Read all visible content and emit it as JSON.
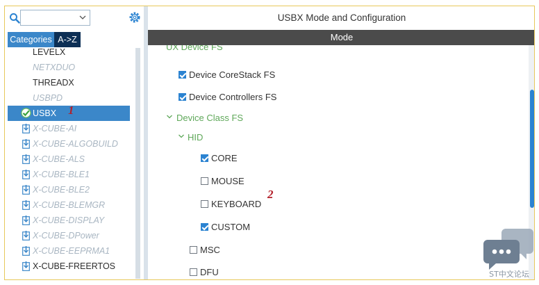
{
  "left_panel": {
    "search": {
      "value": "",
      "placeholder": ""
    },
    "tabs": [
      {
        "label": "Categories",
        "active": false
      },
      {
        "label": "A->Z",
        "active": true
      }
    ],
    "tree_items": [
      {
        "label": "LEVELX",
        "style": "plain"
      },
      {
        "label": "NETXDUO",
        "style": "muted"
      },
      {
        "label": "THREADX",
        "style": "plain"
      },
      {
        "label": "USBPD",
        "style": "muted"
      },
      {
        "label": "USBX",
        "style": "selected",
        "icon": "green-check-icon"
      },
      {
        "label": "X-CUBE-AI",
        "style": "muted",
        "icon": "download-icon"
      },
      {
        "label": "X-CUBE-ALGOBUILD",
        "style": "muted",
        "icon": "download-icon"
      },
      {
        "label": "X-CUBE-ALS",
        "style": "muted",
        "icon": "download-icon"
      },
      {
        "label": "X-CUBE-BLE1",
        "style": "muted",
        "icon": "download-icon"
      },
      {
        "label": "X-CUBE-BLE2",
        "style": "muted",
        "icon": "download-icon"
      },
      {
        "label": "X-CUBE-BLEMGR",
        "style": "muted",
        "icon": "download-icon"
      },
      {
        "label": "X-CUBE-DISPLAY",
        "style": "muted",
        "icon": "download-icon"
      },
      {
        "label": "X-CUBE-DPower",
        "style": "muted",
        "icon": "download-icon"
      },
      {
        "label": "X-CUBE-EEPRMA1",
        "style": "muted",
        "icon": "download-icon"
      },
      {
        "label": "X-CUBE-FREERTOS",
        "style": "plain",
        "icon": "download-icon"
      }
    ],
    "annotation": "1"
  },
  "right_panel": {
    "title": "USBX Mode and Configuration",
    "mode_bar": "Mode",
    "cut_off_label": "UX Device FS",
    "options": [
      {
        "label": "Device CoreStack FS",
        "checked": true,
        "type": "checkbox"
      },
      {
        "label": "Device Controllers FS",
        "checked": true,
        "type": "checkbox"
      },
      {
        "label": "Device Class FS",
        "type": "group"
      },
      {
        "label": "HID",
        "type": "subgroup"
      },
      {
        "label": "CORE",
        "checked": true,
        "type": "checkbox"
      },
      {
        "label": "MOUSE",
        "checked": false,
        "type": "checkbox"
      },
      {
        "label": "KEYBOARD",
        "checked": false,
        "type": "checkbox"
      },
      {
        "label": "CUSTOM",
        "checked": true,
        "type": "checkbox"
      },
      {
        "label": "MSC",
        "checked": false,
        "type": "checkbox"
      },
      {
        "label": "DFU",
        "checked": false,
        "type": "checkbox"
      }
    ],
    "annotation": "2"
  },
  "watermark": {
    "text": "ST中文论坛"
  },
  "colors": {
    "accent": "#3b87c9",
    "dark_tab": "#0d2f55",
    "mode_bar": "#4b4b4b",
    "group_green": "#5fa85a",
    "checkbox_blue": "#2b83d1",
    "annotation_red": "#b3202a"
  }
}
